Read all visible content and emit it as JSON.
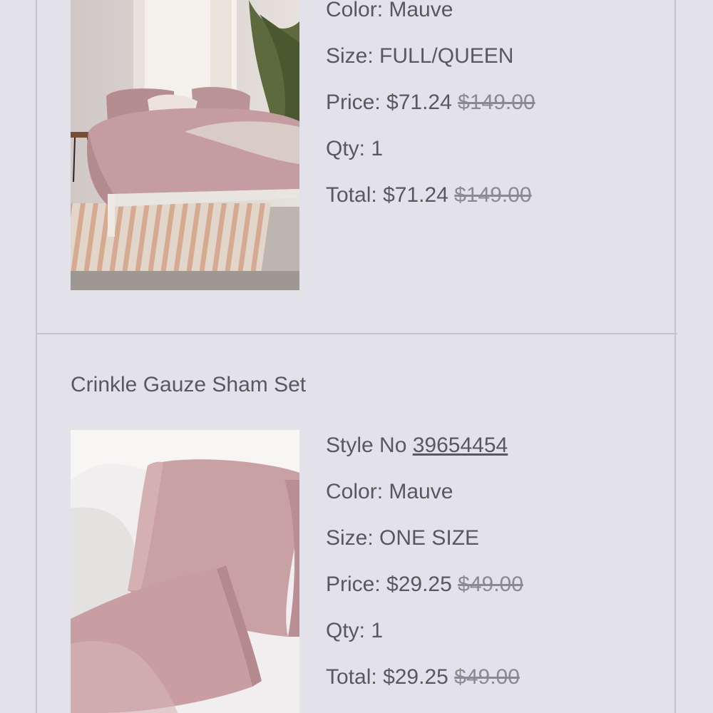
{
  "items": [
    {
      "color_label": "Color:",
      "color_value": "Mauve",
      "size_label": "Size:",
      "size_value": "FULL/QUEEN",
      "price_label": "Price:",
      "price_sale": "$71.24",
      "price_original": "$149.00",
      "qty_label": "Qty:",
      "qty_value": "1",
      "total_label": "Total:",
      "total_sale": "$71.24",
      "total_original": "$149.00",
      "image_icon": "bedroom-duvet-photo"
    },
    {
      "name": "Crinkle Gauze Sham Set",
      "style_label": "Style No",
      "style_number": "39654454",
      "color_label": "Color:",
      "color_value": "Mauve",
      "size_label": "Size:",
      "size_value": "ONE SIZE",
      "price_label": "Price:",
      "price_sale": "$29.25",
      "price_original": "$49.00",
      "qty_label": "Qty:",
      "qty_value": "1",
      "total_label": "Total:",
      "total_sale": "$29.25",
      "total_original": "$49.00",
      "image_icon": "pillow-shams-photo"
    }
  ],
  "colors": {
    "background": "#e3e2e9",
    "text": "#58585e",
    "strike_text": "#8b8a91",
    "border": "#c4c3cb",
    "product_mauve": "#c9a0a4"
  }
}
